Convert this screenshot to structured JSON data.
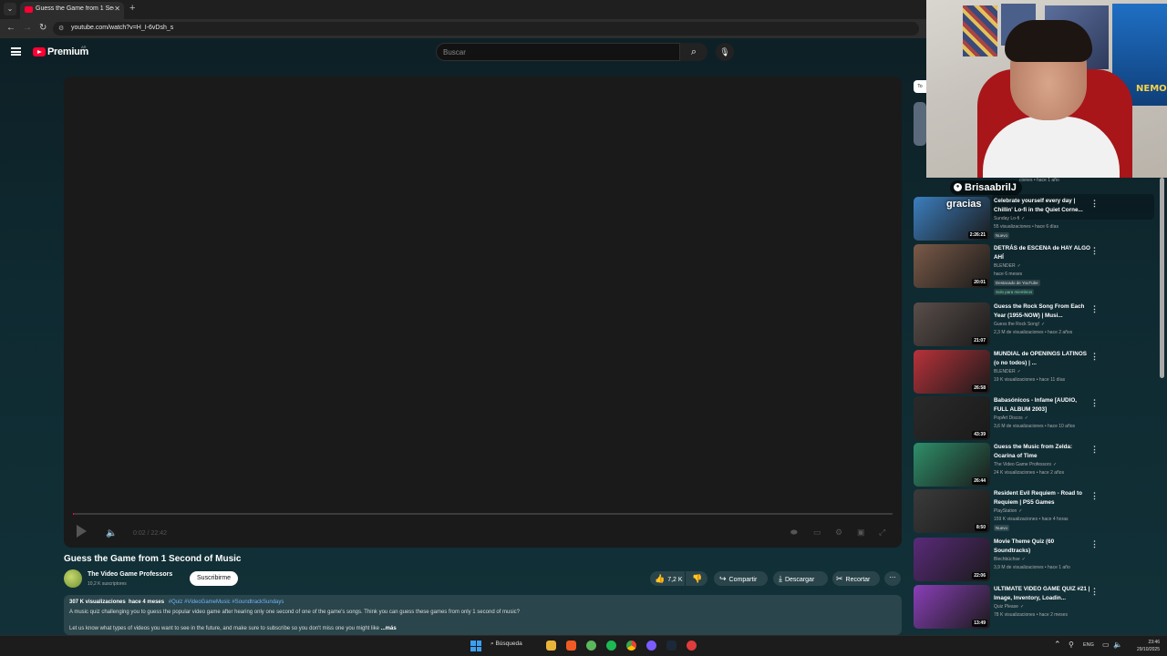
{
  "browser": {
    "tab_title": "Guess the Game from 1 Second of Music - YouTube",
    "url": "youtube.com/watch?v=H_I-6vDsh_s"
  },
  "header": {
    "logo_text": "Premium",
    "country_code": "AR",
    "search_placeholder": "Buscar"
  },
  "player": {
    "time": "0:02 / 22:42",
    "progress": 0.0015
  },
  "video": {
    "title": "Guess the Game from 1 Second of Music",
    "channel": "The Video Game Professors",
    "subscribers": "10,2 K suscriptores",
    "subscribe_label": "Suscribirme",
    "likes": "7,2 K",
    "share_label": "Compartir",
    "download_label": "Descargar",
    "clip_label": "Recortar",
    "description": {
      "views": "307 K visualizaciones",
      "age": "hace 4 meses",
      "tags": "#Quiz #VideoGameMusic #SoundtrackSundays",
      "line1": "A music quiz challenging you to guess the popular video game after hearing only one second of one of the game's songs. Think you can guess these games from only 1 second of music?",
      "line2": "Let us know what types of videos you want to see in the future, and make sure to subscribe so you don't miss one you might like",
      "more_label": "...más"
    }
  },
  "sidebar": {
    "filter_chip": "To",
    "first_meta": "ciones • hace 1 año",
    "items": [
      {
        "title": "Celebrate yourself every day | Chillin' Lo-fi in the Quiet Corne...",
        "channel": "Sunday Lo-fi",
        "meta": "55 visualizaciones • hace 6 días",
        "badge": "Nuevo",
        "duration": "2:26:21",
        "thumb": "#3c7fbf"
      },
      {
        "title": "DETRÁS de ESCENA de HAY ALGO AHÍ",
        "channel": "BLENDER",
        "meta": "hace 6 meses",
        "badge": "Destacado de YouTube",
        "badge2": "Solo para miembros",
        "duration": "20:01",
        "thumb": "#7a5a48"
      },
      {
        "title": "Guess the Rock Song From Each Year (1955-NOW) | Musi...",
        "channel": "Guess the Rock Song!",
        "meta": "2,3 M de visualizaciones • hace 2 años",
        "duration": "21:07",
        "thumb": "#5a4e4a"
      },
      {
        "title": "MUNDIAL de OPENINGS LATINOS (o no todos) | ...",
        "channel": "BLENDER",
        "meta": "19 K visualizaciones • hace 11 días",
        "duration": "26:58",
        "thumb": "#b8323a"
      },
      {
        "title": "Babasónicos - Infame [AUDIO, FULL ALBUM 2003]",
        "channel": "PopArt Discos",
        "meta": "3,6 M de visualizaciones • hace 10 años",
        "duration": "43:39",
        "thumb": "#2a2a2a"
      },
      {
        "title": "Guess the Music from Zelda: Ocarina of Time",
        "channel": "The Video Game Professors",
        "meta": "24 K visualizaciones • hace 2 años",
        "duration": "26:44",
        "thumb": "#2f8f6a"
      },
      {
        "title": "Resident Evil Requiem - Road to Requiem | PS5 Games",
        "channel": "PlayStation",
        "meta": "159 K visualizaciones • hace 4 horas",
        "badge": "Nuevo",
        "duration": "8:50",
        "thumb": "#3b3b3b"
      },
      {
        "title": "Movie Theme Quiz (60 Soundtracks)",
        "channel": "Blechbüchse",
        "meta": "3,9 M de visualizaciones • hace 1 año",
        "duration": "22:06",
        "thumb": "#5a2a7a"
      },
      {
        "title": "ULTIMATE VIDEO GAME QUIZ #21 | Image, Inventory, Loadin...",
        "channel": "Quiz Please",
        "meta": "78 K visualizaciones • hace 2 meses",
        "duration": "13:49",
        "thumb": "#8a3fb8"
      }
    ]
  },
  "overlay": {
    "chat_user": "BrisaabrilJ",
    "chat_message": "gracias",
    "poster_text": "NEMO"
  },
  "taskbar": {
    "search_label": "Búsqueda",
    "lang": "ENG",
    "time": "23:46",
    "date": "29/10/2025"
  }
}
